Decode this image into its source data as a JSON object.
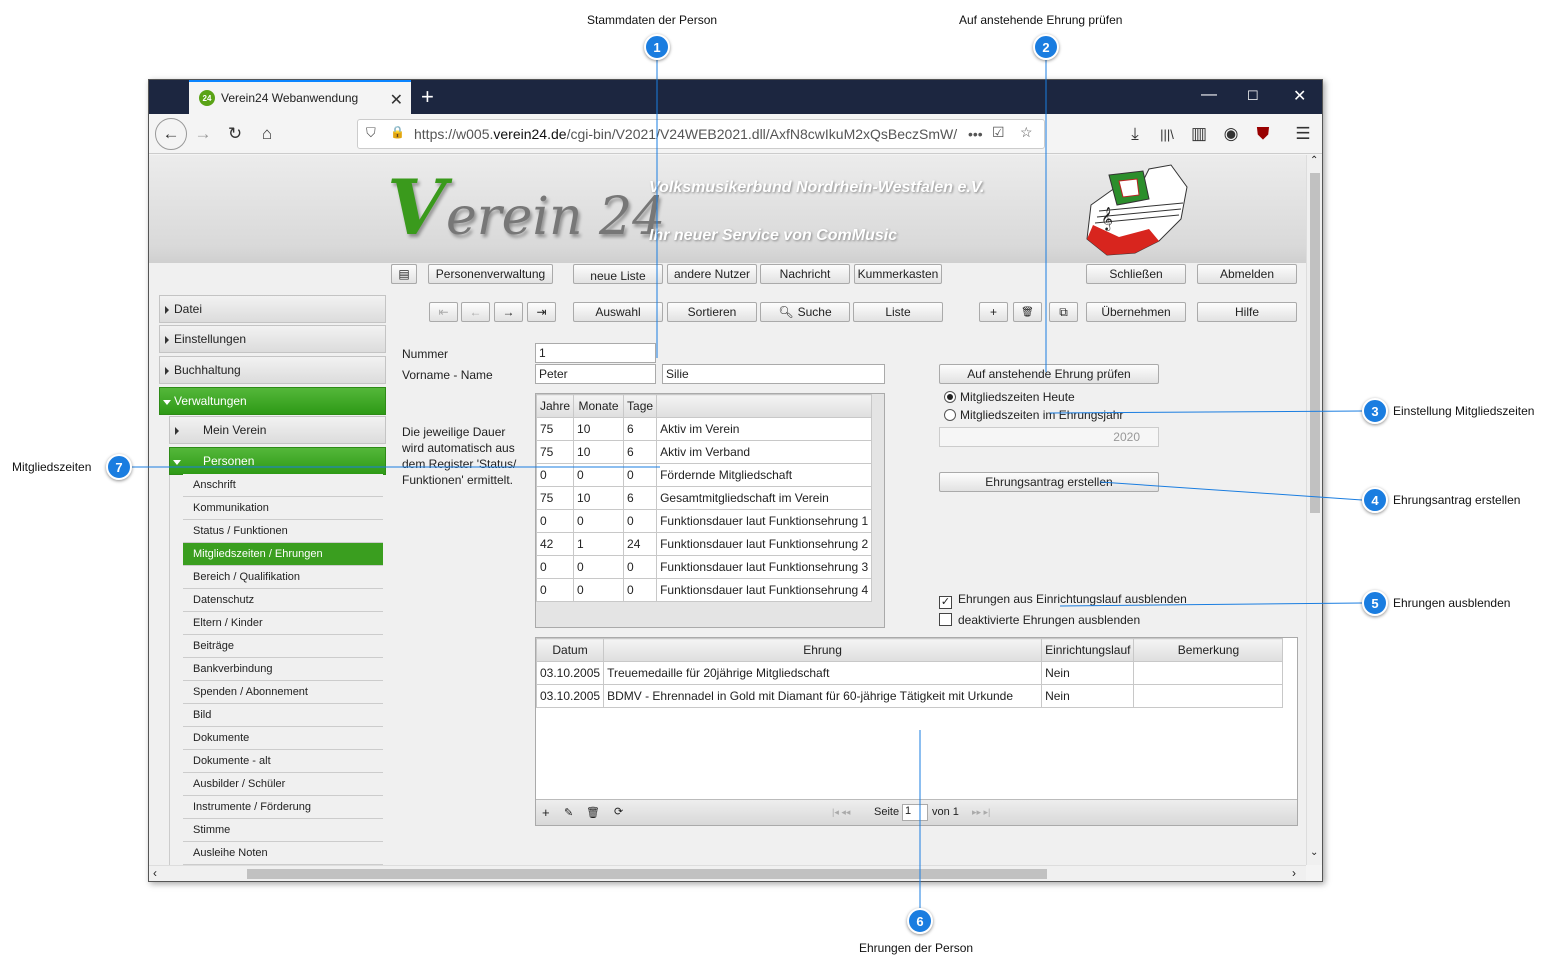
{
  "callouts": [
    {
      "num": "1",
      "text": "Stammdaten der Person"
    },
    {
      "num": "2",
      "text": "Auf anstehende Ehrung prüfen"
    },
    {
      "num": "3",
      "text": "Einstellung Mitgliedszeiten"
    },
    {
      "num": "4",
      "text": "Ehrungsantrag erstellen"
    },
    {
      "num": "5",
      "text": "Ehrungen ausblenden"
    },
    {
      "num": "6",
      "text": "Ehrungen der Person"
    },
    {
      "num": "7",
      "text": "Mitgliedszeiten"
    }
  ],
  "browser": {
    "tab_title": "Verein24 Webanwendung",
    "favicon_text": "24",
    "url_prefix": "https://w005.",
    "url_domain": "verein24.de",
    "url_rest": "/cgi-bin/V2021/V24WEB2021.dll/AxfN8cwIkuM2xQsBeczSmW/",
    "url_more": "•••"
  },
  "header": {
    "logo_v": "V",
    "logo_text": "erein 24",
    "org_name": "Volksmusikerbund Nordrhein-Westfalen e.V.",
    "tagline": "Ihr neuer Service von ComMusic"
  },
  "toolbar": {
    "personenverwaltung": "Personenverwaltung",
    "neue_liste": "neue Liste",
    "andere_nutzer": "andere Nutzer",
    "nachricht": "Nachricht",
    "kummerkasten": "Kummerkasten",
    "schliessen": "Schließen",
    "abmelden": "Abmelden"
  },
  "toolbar2": {
    "first": "⇤",
    "prev": "←",
    "next": "→",
    "last": "⇥",
    "auswahl": "Auswahl",
    "sortieren": "Sortieren",
    "suche": "Suche",
    "liste": "Liste",
    "add": "+",
    "delete": "🗑",
    "copy": "⧉",
    "uebernehmen": "Übernehmen",
    "hilfe": "Hilfe"
  },
  "menu": {
    "datei": "Datei",
    "einstellungen": "Einstellungen",
    "buchhaltung": "Buchhaltung",
    "verwaltungen": "Verwaltungen",
    "mein_verein": "Mein Verein",
    "personen": "Personen",
    "items": [
      "Anschrift",
      "Kommunikation",
      "Status / Funktionen",
      "Mitgliedszeiten / Ehrungen",
      "Bereich / Qualifikation",
      "Datenschutz",
      "Eltern / Kinder",
      "Beiträge",
      "Bankverbindung",
      "Spenden / Abonnement",
      "Bild",
      "Dokumente",
      "Dokumente - alt",
      "Ausbilder / Schüler",
      "Instrumente / Förderung",
      "Stimme",
      "Ausleihe Noten"
    ]
  },
  "form": {
    "nummer_label": "Nummer",
    "nummer_value": "1",
    "name_label": "Vorname - Name",
    "vorname": "Peter",
    "nachname": "Silie",
    "info_text": "Die jeweilige Dauer wird automatisch aus dem Register 'Status/ Funktionen' ermittelt."
  },
  "durations": {
    "headers": [
      "Jahre",
      "Monate",
      "Tage",
      ""
    ],
    "rows": [
      [
        "75",
        "10",
        "6",
        "Aktiv im Verein"
      ],
      [
        "75",
        "10",
        "6",
        "Aktiv im Verband"
      ],
      [
        "0",
        "0",
        "0",
        "Fördernde Mitgliedschaft"
      ],
      [
        "75",
        "10",
        "6",
        "Gesamtmitgliedschaft im Verein"
      ],
      [
        "0",
        "0",
        "0",
        "Funktionsdauer laut Funktionsehrung 1"
      ],
      [
        "42",
        "1",
        "24",
        "Funktionsdauer laut Funktionsehrung 2"
      ],
      [
        "0",
        "0",
        "0",
        "Funktionsdauer laut Funktionsehrung 3"
      ],
      [
        "0",
        "0",
        "0",
        "Funktionsdauer laut Funktionsehrung 4"
      ]
    ]
  },
  "right_panel": {
    "pruefen_button": "Auf anstehende Ehrung prüfen",
    "radio_heute": "Mitgliedszeiten Heute",
    "radio_jahr": "Mitgliedszeiten im Ehrungsjahr",
    "year": "2020",
    "antrag_button": "Ehrungsantrag erstellen",
    "chk_einrichtung": "Ehrungen aus Einrichtungslauf ausblenden",
    "chk_deaktiviert": "deaktivierte Ehrungen ausblenden",
    "check_mark": "✓"
  },
  "honors": {
    "headers": [
      "Datum",
      "Ehrung",
      "Einrichtungslauf",
      "Bemerkung"
    ],
    "rows": [
      [
        "03.10.2005",
        "Treuemedaille für 20jährige Mitgliedschaft",
        "Nein",
        ""
      ],
      [
        "03.10.2005",
        "BDMV - Ehrennadel in Gold mit Diamant für 60-jährige Tätigkeit mit Urkunde",
        "Nein",
        ""
      ]
    ],
    "pager_seite": "Seite",
    "pager_page": "1",
    "pager_von": "von 1"
  }
}
